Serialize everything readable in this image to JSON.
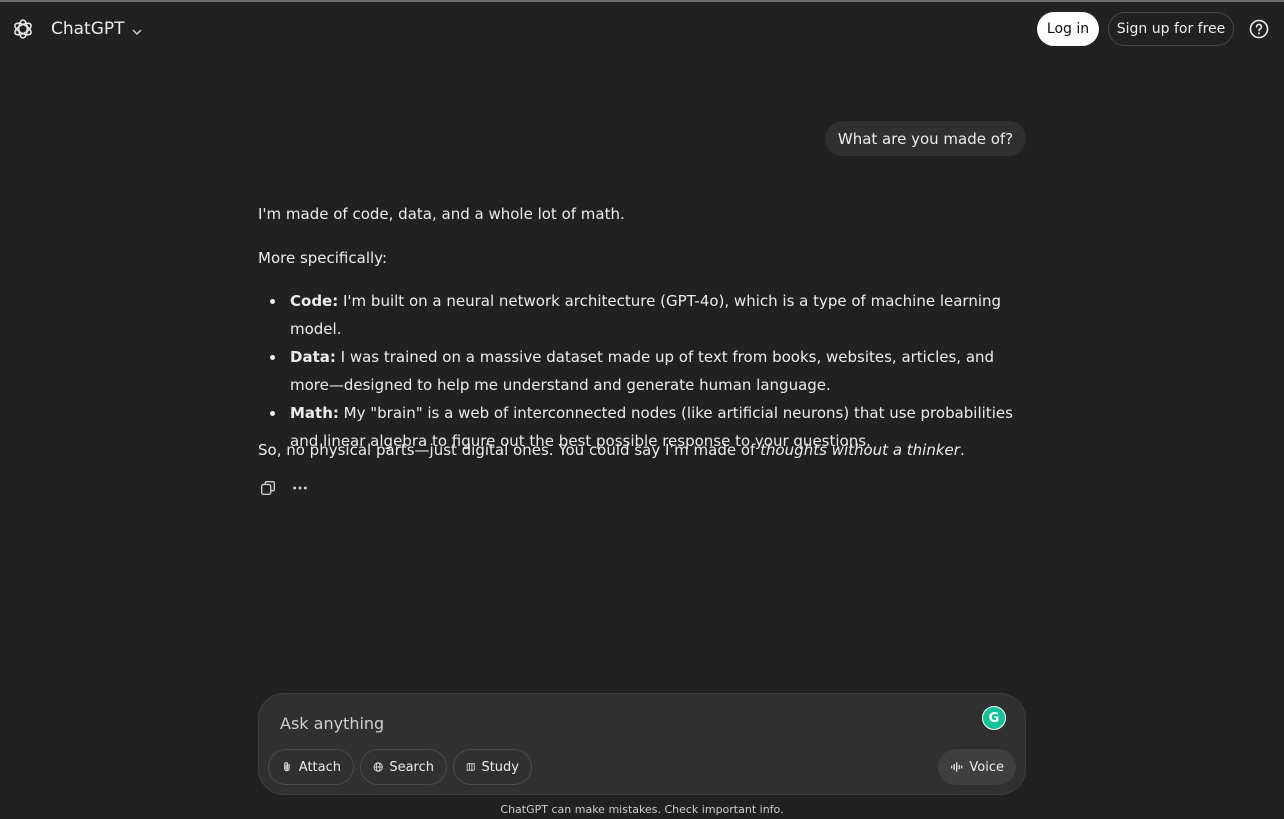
{
  "header": {
    "model_name": "ChatGPT",
    "login_label": "Log in",
    "signup_label": "Sign up for free",
    "icons": {
      "logo": "openai-logo-icon",
      "model_menu": "chevron-down-icon",
      "help": "help-circle-icon"
    }
  },
  "conversation": {
    "user_message": "What are you made of?",
    "assistant": {
      "intro": "I'm made of code, data, and a whole lot of math.",
      "lead": "More specifically:",
      "bullets": [
        {
          "term": "Code:",
          "text": " I'm built on a neural network architecture (GPT-4o), which is a type of machine learning model."
        },
        {
          "term": "Data:",
          "text": " I was trained on a massive dataset made up of text from books, websites, articles, and more—designed to help me understand and generate human language."
        },
        {
          "term": "Math:",
          "text": " My \"brain\" is a web of interconnected nodes (like artificial neurons) that use probabilities and linear algebra to figure out the best possible response to your questions."
        }
      ],
      "closing_prefix": "So, no physical parts—just digital ones. You could say I’m made of ",
      "closing_italic": "thoughts without a thinker",
      "closing_suffix": "."
    },
    "actions": {
      "copy_icon": "copy-icon",
      "more_icon": "more-horizontal-icon"
    }
  },
  "composer": {
    "placeholder": "Ask anything",
    "attach_label": "Attach",
    "search_label": "Search",
    "study_label": "Study",
    "voice_label": "Voice",
    "grammarly_icon": "grammarly-icon",
    "grammarly_letter": "G"
  },
  "footer": {
    "disclaimer": "ChatGPT can make mistakes. Check important info."
  },
  "colors": {
    "background": "#212121",
    "surface": "#303030",
    "text": "#ececec",
    "grammarly": "#15c39a"
  }
}
